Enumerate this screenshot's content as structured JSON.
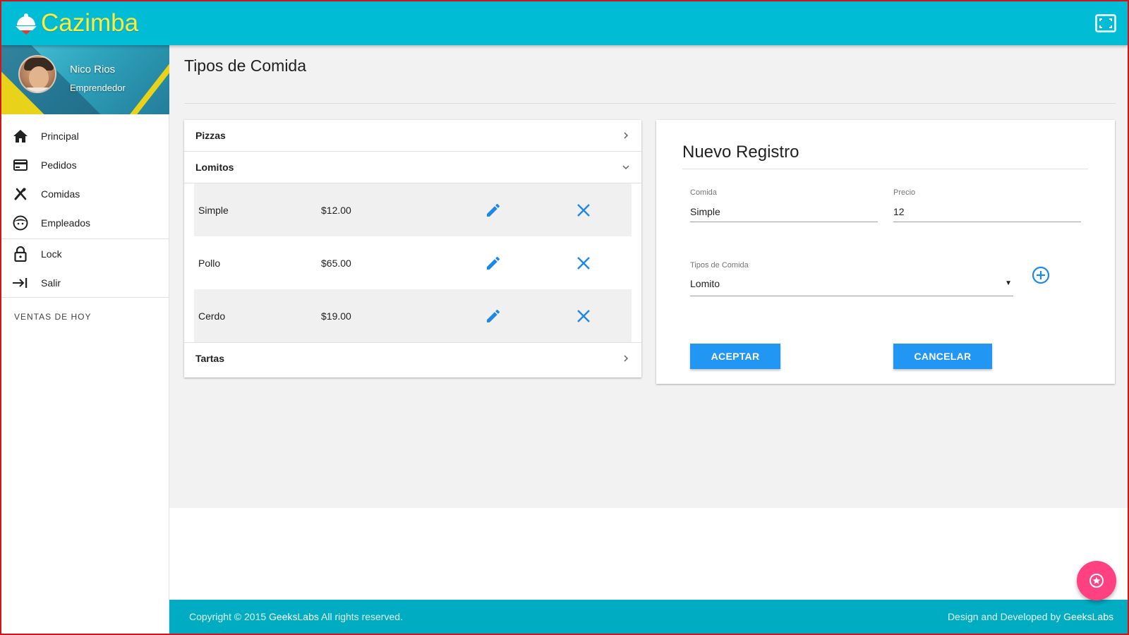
{
  "app": {
    "logo_text": "Cazimba",
    "brand_color": "#00bcd4",
    "logo_color": "#ffeb3b"
  },
  "header": {
    "fullscreen_icon": "fullscreen-icon"
  },
  "profile": {
    "name": "Nico Rios",
    "role": "Emprendedor"
  },
  "sidebar": {
    "items": [
      {
        "label": "Principal",
        "icon": "home-icon"
      },
      {
        "label": "Pedidos",
        "icon": "card-icon"
      },
      {
        "label": "Comidas",
        "icon": "utensils-icon"
      },
      {
        "label": "Empleados",
        "icon": "face-icon"
      },
      {
        "label": "Lock",
        "icon": "lock-icon"
      },
      {
        "label": "Salir",
        "icon": "exit-icon"
      }
    ],
    "subheader": "VENTAS DE HOY"
  },
  "page": {
    "title": "Tipos de Comida"
  },
  "food_types": {
    "sections": [
      {
        "label": "Pizzas",
        "expanded": false
      },
      {
        "label": "Lomitos",
        "expanded": true
      },
      {
        "label": "Tartas",
        "expanded": false
      }
    ],
    "lomitos_items": [
      {
        "name": "Simple",
        "price": "$12.00"
      },
      {
        "name": "Pollo",
        "price": "$65.00"
      },
      {
        "name": "Cerdo",
        "price": "$19.00"
      }
    ]
  },
  "form": {
    "title": "Nuevo Registro",
    "comida_label": "Comida",
    "comida_value": "Simple",
    "precio_label": "Precio",
    "precio_value": "12",
    "tipo_label": "Tipos de Comida",
    "tipo_value": "Lomito",
    "accept_label": "ACEPTAR",
    "cancel_label": "CANCELAR",
    "button_color": "#2196f3"
  },
  "footer": {
    "copyright_prefix": "Copyright © 2015 ",
    "copyright_brand": "GeeksLabs",
    "copyright_suffix": " All rights reserved.",
    "credit_prefix": "Design and Developed by ",
    "credit_brand": "GeeksLabs"
  },
  "fab": {
    "icon": "star-icon",
    "color": "#ff4081"
  }
}
